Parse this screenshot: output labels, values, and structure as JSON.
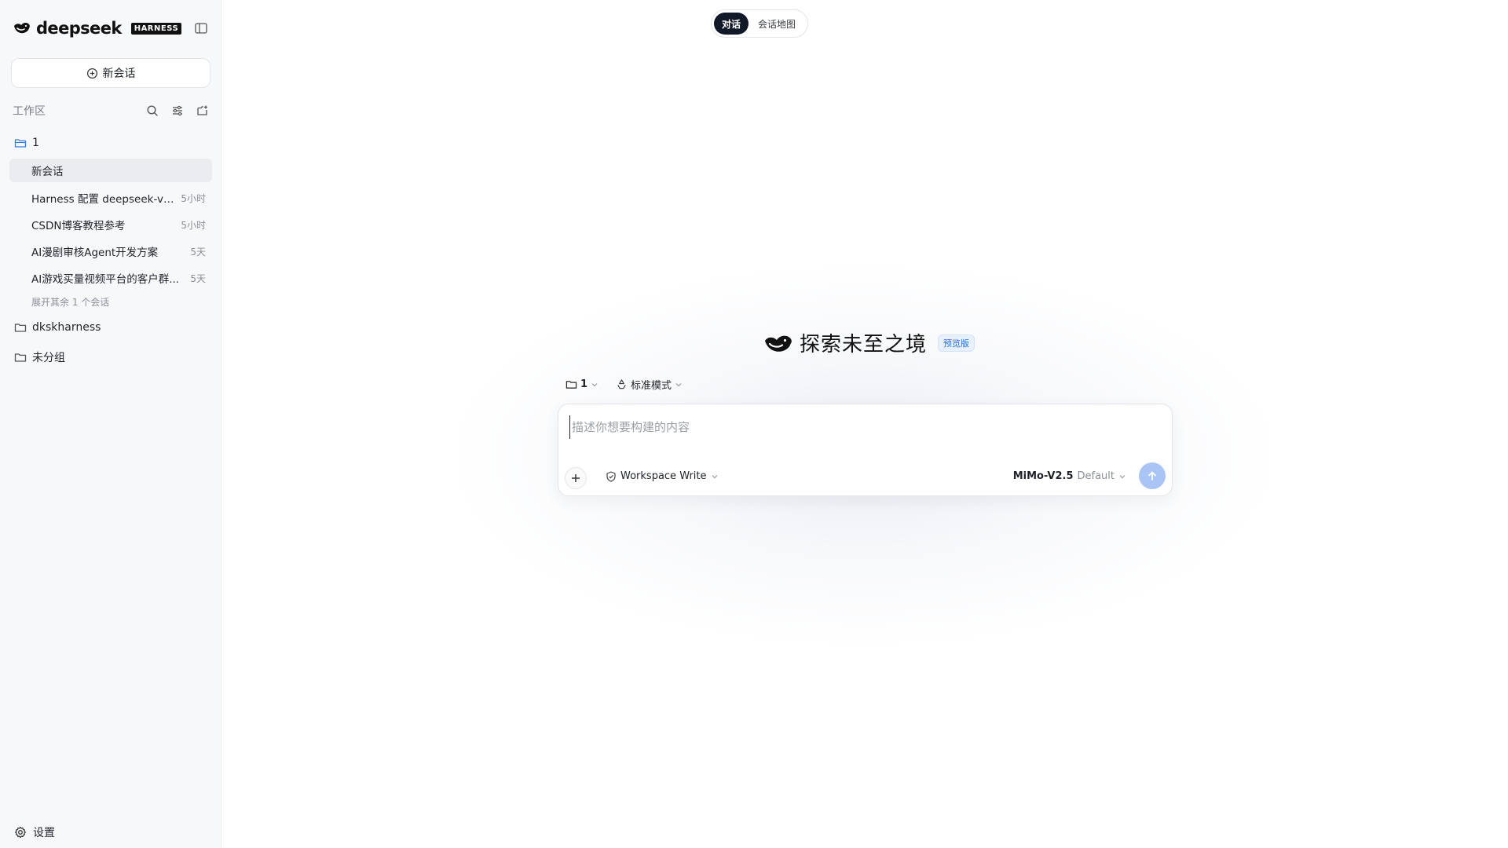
{
  "brand": {
    "name": "deepseek",
    "badge": "HARNESS"
  },
  "sidebar": {
    "new_chat_label": "新会话",
    "workspace_title": "工作区",
    "folders": [
      {
        "name": "1",
        "expanded": true,
        "conversations": [
          {
            "title": "新会话",
            "time": "",
            "active": true
          },
          {
            "title": "Harness 配置 deepseek-v4-f...",
            "time": "5小时",
            "active": false
          },
          {
            "title": "CSDN博客教程参考",
            "time": "5小时",
            "active": false
          },
          {
            "title": "AI漫剧审核Agent开发方案",
            "time": "5天",
            "active": false
          },
          {
            "title": "AI游戏买量视频平台的客户群...",
            "time": "5天",
            "active": false
          }
        ],
        "expand_more_label": "展开其余 1 个会话"
      },
      {
        "name": "dkskharness",
        "expanded": false
      },
      {
        "name": "未分组",
        "expanded": false
      }
    ],
    "settings_label": "设置"
  },
  "view_toggle": {
    "tabs": [
      {
        "label": "对话",
        "active": true
      },
      {
        "label": "会话地图",
        "active": false
      }
    ]
  },
  "hero": {
    "title": "探索未至之境",
    "badge": "预览版"
  },
  "composer": {
    "folder_value": "1",
    "mode_value": "标准模式",
    "input_value": "",
    "placeholder": "描述你想要构建的内容",
    "permission_mode": "Workspace Write",
    "model_name": "MiMo-V2.5",
    "model_variant": "Default"
  },
  "colors": {
    "accent": "#2f6fd6",
    "send_button": "#a9c4f5",
    "active_tab": "#111827",
    "sidebar_bg": "#f7f8fa",
    "folder_active_icon": "#3b7ddd"
  }
}
